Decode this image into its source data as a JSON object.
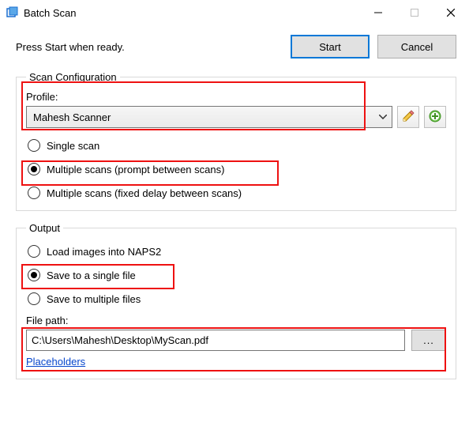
{
  "window": {
    "title": "Batch Scan"
  },
  "instructions": "Press Start when ready.",
  "buttons": {
    "start": "Start",
    "cancel": "Cancel",
    "browse": "..."
  },
  "scan_config": {
    "legend": "Scan Configuration",
    "profile_label": "Profile:",
    "profile_value": "Mahesh Scanner",
    "radios": {
      "single": "Single scan",
      "multi_prompt": "Multiple scans (prompt between scans)",
      "multi_delay": "Multiple scans (fixed delay between scans)"
    },
    "icons": {
      "edit": "pencil-icon",
      "add": "add-icon"
    }
  },
  "output": {
    "legend": "Output",
    "radios": {
      "load": "Load images into NAPS2",
      "single_file": "Save to a single file",
      "multi_file": "Save to multiple files"
    },
    "filepath_label": "File path:",
    "filepath_value": "C:\\Users\\Mahesh\\Desktop\\MyScan.pdf",
    "placeholders_link": "Placeholders"
  }
}
